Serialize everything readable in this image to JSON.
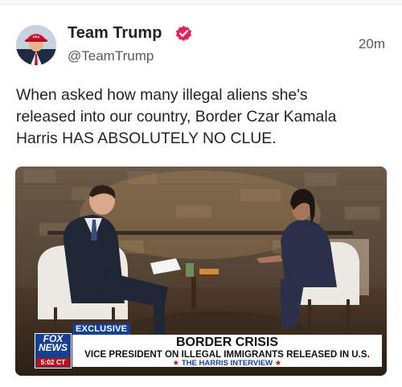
{
  "tweet": {
    "author_name": "Team Trump",
    "handle": "@TeamTrump",
    "timestamp": "20m",
    "verified_badge_icon": "verified-badge-icon",
    "text_lines": [
      "When asked how many illegal aliens she's",
      "released into our country, Border Czar Kamala",
      "Harris HAS ABSOLUTELY NO CLUE."
    ]
  },
  "media": {
    "network": {
      "line1": "FOX",
      "line2": "NEWS",
      "clock": "5:02 CT"
    },
    "tag": "EXCLUSIVE",
    "headline": "BORDER CRISIS",
    "subheadline": "VICE PRESIDENT ON ILLEGAL IMMIGRANTS RELEASED IN U.S.",
    "footer_star": "★",
    "footer": "THE HARRIS INTERVIEW"
  },
  "colors": {
    "verified": "#e0245e",
    "fox_blue": "#163f8f",
    "fox_red": "#b5121b"
  }
}
